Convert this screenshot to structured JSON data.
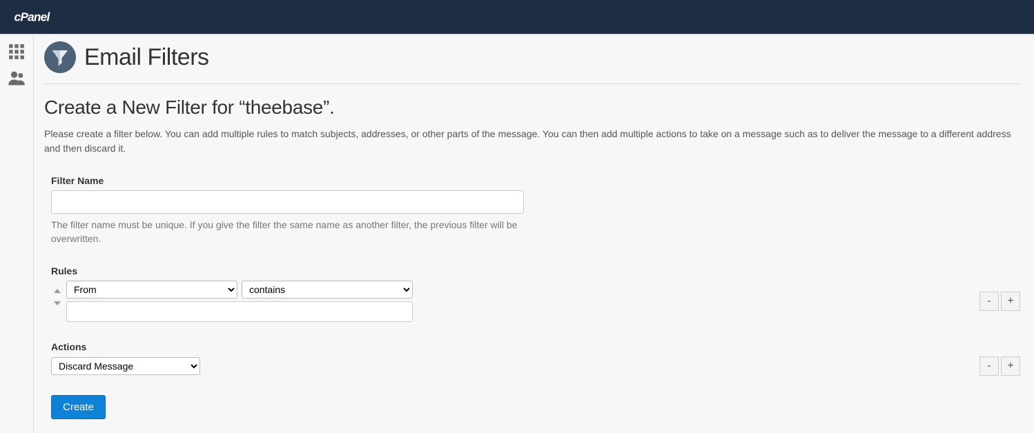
{
  "header": {
    "logo_text": "cPanel"
  },
  "page": {
    "title": "Email Filters",
    "subheading": "Create a New Filter for “theebase”.",
    "description": "Please create a filter below. You can add multiple rules to match subjects, addresses, or other parts of the message. You can then add multiple actions to take on a message such as to deliver the message to a different address and then discard it."
  },
  "form": {
    "filter_name_label": "Filter Name",
    "filter_name_value": "",
    "filter_name_help": "The filter name must be unique. If you give the filter the same name as another filter, the previous filter will be overwritten.",
    "rules_label": "Rules",
    "rule_field_selected": "From",
    "rule_operator_selected": "contains",
    "rule_value": "",
    "actions_label": "Actions",
    "action_selected": "Discard Message",
    "create_label": "Create",
    "minus_label": "-",
    "plus_label": "+"
  }
}
